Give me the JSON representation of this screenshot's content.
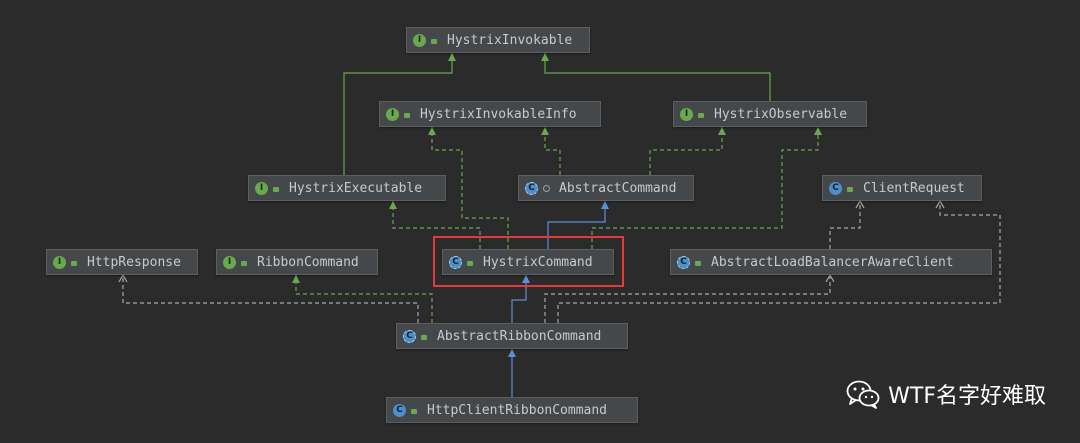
{
  "nodes": [
    {
      "id": "hystrix_invokable",
      "label": "HystrixInvokable",
      "kind": "interface",
      "access": "public"
    },
    {
      "id": "hystrix_invokable_info",
      "label": "HystrixInvokableInfo",
      "kind": "interface",
      "access": "public"
    },
    {
      "id": "hystrix_observable",
      "label": "HystrixObservable",
      "kind": "interface",
      "access": "public"
    },
    {
      "id": "hystrix_executable",
      "label": "HystrixExecutable",
      "kind": "interface",
      "access": "public"
    },
    {
      "id": "abstract_command",
      "label": "AbstractCommand",
      "kind": "abstract",
      "access": "package"
    },
    {
      "id": "client_request",
      "label": "ClientRequest",
      "kind": "class",
      "access": "public"
    },
    {
      "id": "http_response",
      "label": "HttpResponse",
      "kind": "interface",
      "access": "public"
    },
    {
      "id": "ribbon_command",
      "label": "RibbonCommand",
      "kind": "interface",
      "access": "public"
    },
    {
      "id": "hystrix_command",
      "label": "HystrixCommand",
      "kind": "abstract",
      "access": "public"
    },
    {
      "id": "abstract_lb_client",
      "label": "AbstractLoadBalancerAwareClient",
      "kind": "abstract",
      "access": "public"
    },
    {
      "id": "abstract_ribbon_command",
      "label": "AbstractRibbonCommand",
      "kind": "abstract",
      "access": "public"
    },
    {
      "id": "http_client_ribbon_command",
      "label": "HttpClientRibbonCommand",
      "kind": "class",
      "access": "public"
    }
  ],
  "relations": [
    {
      "from": "hystrix_executable",
      "to": "hystrix_invokable",
      "type": "extends-interface"
    },
    {
      "from": "hystrix_observable",
      "to": "hystrix_invokable",
      "type": "extends-interface"
    },
    {
      "from": "abstract_command",
      "to": "hystrix_invokable_info",
      "type": "implements"
    },
    {
      "from": "abstract_command",
      "to": "hystrix_observable",
      "type": "implements"
    },
    {
      "from": "hystrix_command",
      "to": "hystrix_invokable_info",
      "type": "implements"
    },
    {
      "from": "hystrix_command",
      "to": "hystrix_executable",
      "type": "implements"
    },
    {
      "from": "hystrix_command",
      "to": "abstract_command",
      "type": "extends-class"
    },
    {
      "from": "hystrix_command",
      "to": "hystrix_observable",
      "type": "implements"
    },
    {
      "from": "abstract_ribbon_command",
      "to": "hystrix_command",
      "type": "extends-class"
    },
    {
      "from": "abstract_ribbon_command",
      "to": "ribbon_command",
      "type": "implements"
    },
    {
      "from": "abstract_ribbon_command",
      "to": "http_response",
      "type": "dependency"
    },
    {
      "from": "abstract_ribbon_command",
      "to": "abstract_lb_client",
      "type": "dependency"
    },
    {
      "from": "abstract_ribbon_command",
      "to": "client_request",
      "type": "dependency"
    },
    {
      "from": "abstract_lb_client",
      "to": "client_request",
      "type": "dependency"
    },
    {
      "from": "http_client_ribbon_command",
      "to": "abstract_ribbon_command",
      "type": "extends-class"
    }
  ],
  "highlighted_node": "hystrix_command",
  "icons": {
    "interface": "I",
    "class": "C",
    "abstract": "C"
  },
  "colors": {
    "background": "#2b2b2b",
    "node_fill": "#45484a",
    "node_text": "#c7cacc",
    "interface_green": "#6aa84f",
    "class_blue": "#4f8fc9",
    "extends_class_line": "#5b8fd6",
    "interface_line": "#6aa84f",
    "dependency_line": "#a9a9a9",
    "highlight_red": "#e33b3b"
  },
  "watermark": {
    "text": "WTF名字好难取",
    "icon": "wechat-icon"
  }
}
